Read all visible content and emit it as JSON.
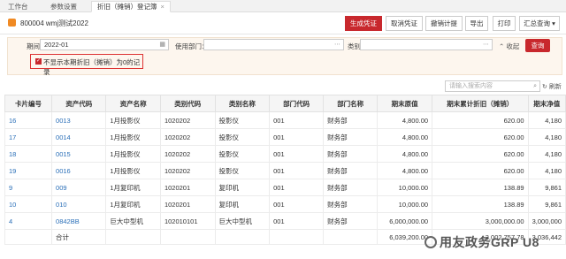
{
  "tabs": [
    {
      "label": "工作台"
    },
    {
      "label": "参数设置"
    },
    {
      "label": "折旧（摊销）登记簿",
      "active": true
    }
  ],
  "app": {
    "title": "800004 wmj测试2022"
  },
  "toolbar": {
    "generate": "生成凭证",
    "cancel": "取消凭证",
    "withdraw": "撤销计提",
    "export": "导出",
    "print": "打印",
    "summary": "汇总查询"
  },
  "filter": {
    "period_label": "期间：",
    "period_value": "2022-01",
    "dept_label": "使用部门：",
    "dept_value": "",
    "category_label": "类别：",
    "category_value": "",
    "collapse": "收起",
    "query": "查询",
    "hide_zero_label": "不显示本期折旧（摊销）为0的记录",
    "hide_zero_checked": true
  },
  "search": {
    "placeholder": "请输入搜索内容",
    "refresh": "刷新"
  },
  "table": {
    "headers": [
      "卡片编号",
      "资产代码",
      "资产名称",
      "类别代码",
      "类别名称",
      "部门代码",
      "部门名称",
      "期末原值",
      "期末累计折旧（摊销）",
      "期末净值"
    ],
    "rows": [
      [
        "16",
        "0013",
        "1月投影仪",
        "1020202",
        "投影仪",
        "001",
        "财务部",
        "4,800.00",
        "620.00",
        "4,180"
      ],
      [
        "17",
        "0014",
        "1月投影仪",
        "1020202",
        "投影仪",
        "001",
        "财务部",
        "4,800.00",
        "620.00",
        "4,180"
      ],
      [
        "18",
        "0015",
        "1月投影仪",
        "1020202",
        "投影仪",
        "001",
        "财务部",
        "4,800.00",
        "620.00",
        "4,180"
      ],
      [
        "19",
        "0016",
        "1月投影仪",
        "1020202",
        "投影仪",
        "001",
        "财务部",
        "4,800.00",
        "620.00",
        "4,180"
      ],
      [
        "9",
        "009",
        "1月复印机",
        "1020201",
        "复印机",
        "001",
        "财务部",
        "10,000.00",
        "138.89",
        "9,861"
      ],
      [
        "10",
        "010",
        "1月复印机",
        "1020201",
        "复印机",
        "001",
        "财务部",
        "10,000.00",
        "138.89",
        "9,861"
      ],
      [
        "4",
        "0842BB",
        "巨大中型机",
        "102010101",
        "巨大中型机",
        "001",
        "财务部",
        "6,000,000.00",
        "3,000,000.00",
        "3,000,000"
      ]
    ],
    "total": [
      "",
      "合计",
      "",
      "",
      "",
      "",
      "",
      "6,039,200.00",
      "3,002,757.78",
      "3,036,442"
    ]
  },
  "watermark": {
    "text": "用友政务GRP U8"
  }
}
